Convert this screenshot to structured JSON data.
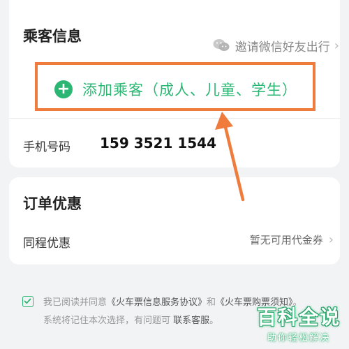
{
  "passenger": {
    "title": "乘客信息",
    "invite_label": "邀请微信好友出行",
    "add_label": "添加乘客（成人、儿童、学生）",
    "phone_label": "手机号码",
    "phone_value": "159 3521 1544"
  },
  "discount": {
    "title": "订单优惠",
    "trip_label": "同程优惠",
    "coupon_status": "暂无可用代金券"
  },
  "agreement": {
    "prefix": "我已阅读并同意",
    "doc1": "《火车票信息服务协议》",
    "and": "和",
    "doc2": "《火车票购票须知》",
    "suffix": "。",
    "line2_prefix": "系统将记住本次选择，有问题可 ",
    "contact": "联系客服",
    "line2_suffix": "。"
  },
  "watermark": {
    "title": "百科全说",
    "subtitle": "助你轻松解决"
  },
  "colors": {
    "accent_green": "#2bb673",
    "highlight_orange": "#ef7b3d"
  }
}
